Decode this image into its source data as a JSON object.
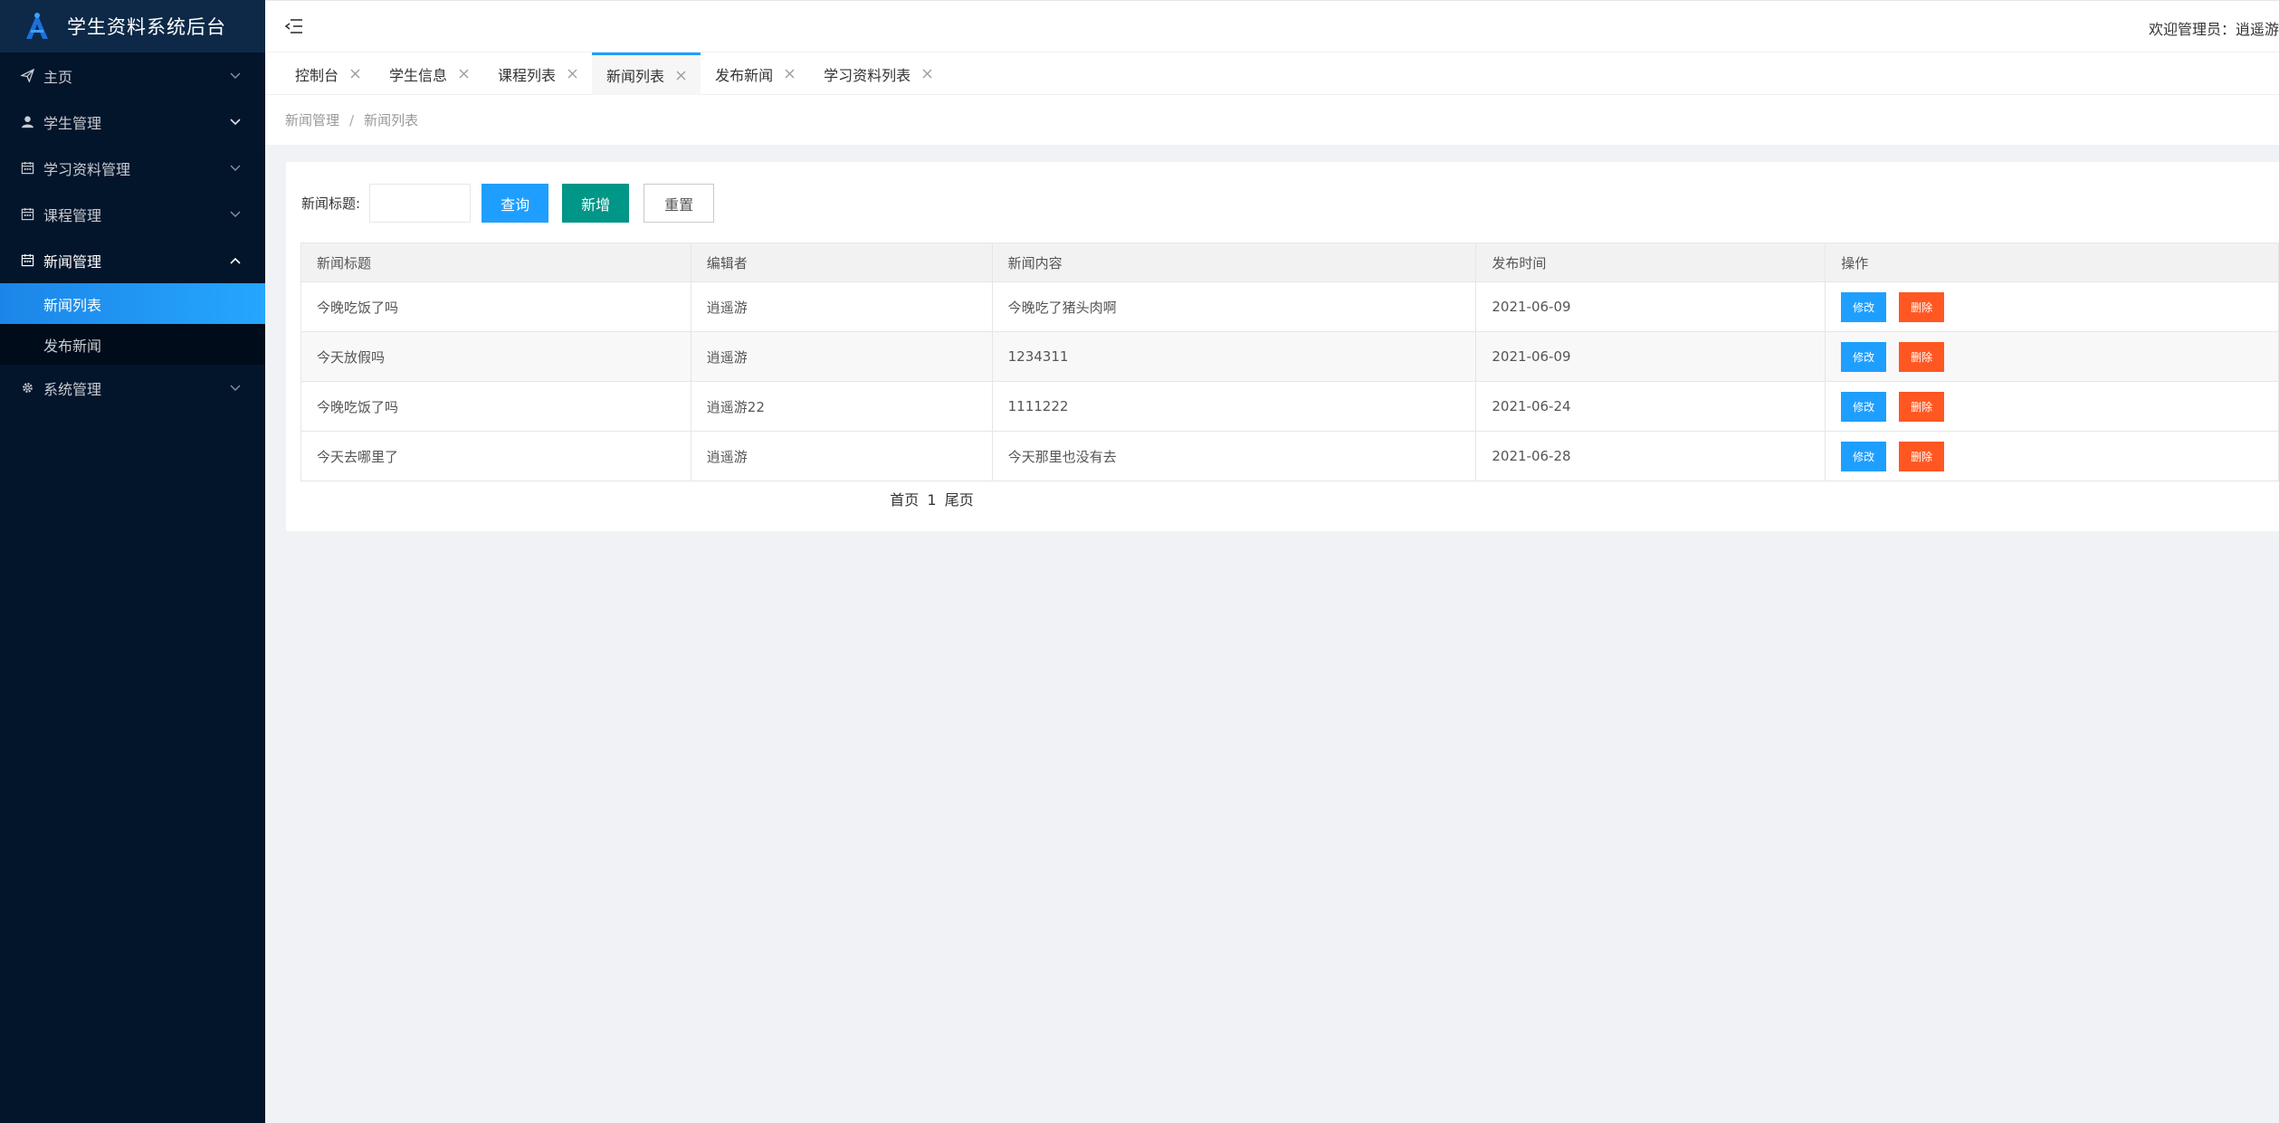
{
  "app": {
    "title": "学生资料系统后台"
  },
  "sidebar": {
    "items": [
      {
        "label": "主页",
        "icon": "send-icon"
      },
      {
        "label": "学生管理",
        "icon": "user-icon"
      },
      {
        "label": "学习资料管理",
        "icon": "calendar-icon"
      },
      {
        "label": "课程管理",
        "icon": "calendar-icon"
      },
      {
        "label": "新闻管理",
        "icon": "calendar-icon",
        "open": true,
        "children": [
          {
            "label": "新闻列表",
            "active": true
          },
          {
            "label": "发布新闻"
          }
        ]
      },
      {
        "label": "系统管理",
        "icon": "gear-icon"
      }
    ]
  },
  "header": {
    "welcome": "欢迎管理员：逍遥游"
  },
  "tabs": [
    {
      "label": "控制台"
    },
    {
      "label": "学生信息"
    },
    {
      "label": "课程列表"
    },
    {
      "label": "新闻列表",
      "active": true
    },
    {
      "label": "发布新闻"
    },
    {
      "label": "学习资料列表"
    }
  ],
  "breadcrumb": {
    "parent": "新闻管理",
    "separator": "/",
    "current": "新闻列表"
  },
  "search": {
    "label": "新闻标题:",
    "value": "",
    "query_label": "查询",
    "add_label": "新增",
    "reset_label": "重置"
  },
  "table": {
    "columns": [
      "新闻标题",
      "编辑者",
      "新闻内容",
      "发布时间",
      "操作"
    ],
    "edit_label": "修改",
    "delete_label": "删除",
    "rows": [
      {
        "title": "今晚吃饭了吗",
        "editor": "逍遥游",
        "content": "今晚吃了猪头肉啊",
        "date": "2021-06-09"
      },
      {
        "title": "今天放假吗",
        "editor": "逍遥游",
        "content": "1234311",
        "date": "2021-06-09"
      },
      {
        "title": "今晚吃饭了吗",
        "editor": "逍遥游22",
        "content": "1111222",
        "date": "2021-06-24"
      },
      {
        "title": "今天去哪里了",
        "editor": "逍遥游",
        "content": "今天那里也没有去",
        "date": "2021-06-28"
      }
    ]
  },
  "pager": {
    "first_label": "首页",
    "current_page": "1",
    "last_label": "尾页"
  },
  "colors": {
    "sidebar_bg": "#03152b",
    "logo_bg": "#0d2947",
    "accent_blue": "#1e9fff",
    "accent_green": "#009688",
    "danger_orange": "#ff5722"
  }
}
